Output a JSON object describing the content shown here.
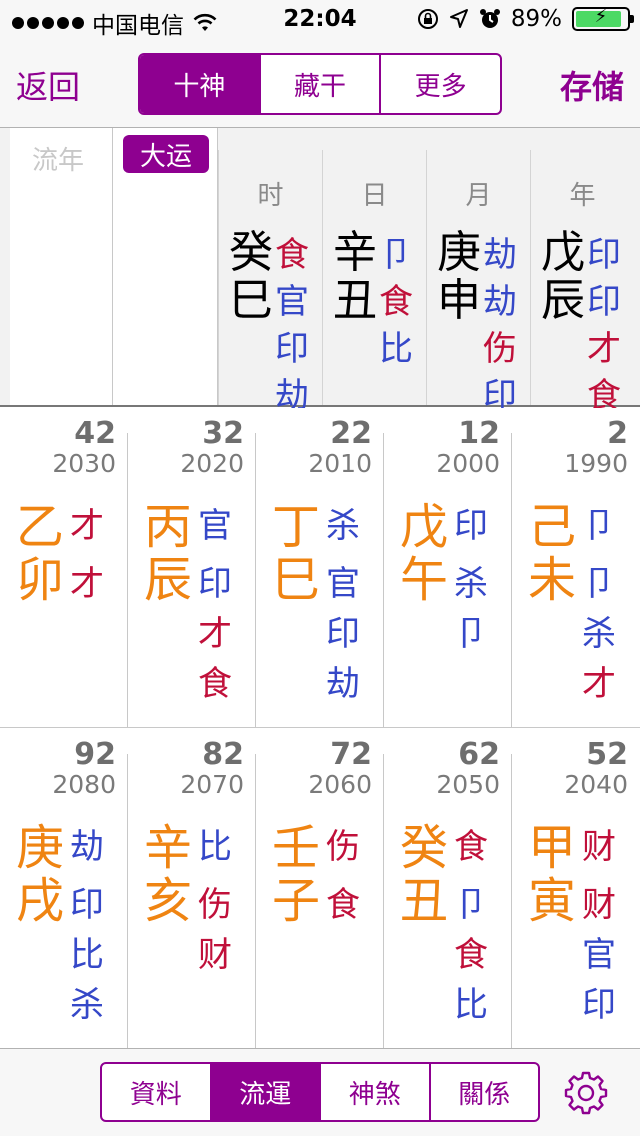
{
  "status_bar": {
    "carrier": "中国电信",
    "time": "22:04",
    "battery_percent": "89%",
    "battery_level": 0.89,
    "signal_icon": "signal-dots-icon",
    "wifi_icon": "wifi-icon",
    "battery_color": "#4cd964"
  },
  "nav": {
    "back_label": "返回",
    "save_label": "存储",
    "segments": [
      {
        "label": "十神",
        "active": true
      },
      {
        "label": "藏干",
        "active": false
      },
      {
        "label": "更多",
        "active": false
      }
    ],
    "accent_color": "#8e0090"
  },
  "header": {
    "liunian_label": "流年",
    "dayun_label": "大运",
    "pillars": [
      {
        "label": "时",
        "stem": "癸",
        "branch": "巳",
        "gods": [
          {
            "t": "食",
            "c": "red"
          },
          {
            "t": "官",
            "c": "blue"
          },
          {
            "t": "印",
            "c": "blue"
          },
          {
            "t": "劫",
            "c": "blue"
          }
        ]
      },
      {
        "label": "日",
        "stem": "辛",
        "branch": "丑",
        "gods": [
          {
            "t": "",
            "c": "blue"
          },
          {
            "t": "卩",
            "c": "blue"
          },
          {
            "t": "食",
            "c": "red"
          },
          {
            "t": "比",
            "c": "blue"
          }
        ]
      },
      {
        "label": "月",
        "stem": "庚",
        "branch": "申",
        "gods": [
          {
            "t": "劫",
            "c": "blue"
          },
          {
            "t": "劫",
            "c": "blue"
          },
          {
            "t": "伤",
            "c": "red"
          },
          {
            "t": "印",
            "c": "blue"
          }
        ]
      },
      {
        "label": "年",
        "stem": "戊",
        "branch": "辰",
        "gods": [
          {
            "t": "印",
            "c": "blue"
          },
          {
            "t": "印",
            "c": "blue"
          },
          {
            "t": "才",
            "c": "red"
          },
          {
            "t": "食",
            "c": "red"
          }
        ]
      }
    ]
  },
  "dayun_rows": [
    [
      {
        "age": "42",
        "year": "2030",
        "stem": "乙",
        "branch": "卯",
        "stem_god": {
          "t": "才",
          "c": "red"
        },
        "branch_gods": [
          {
            "t": "才",
            "c": "red"
          }
        ]
      },
      {
        "age": "32",
        "year": "2020",
        "stem": "丙",
        "branch": "辰",
        "stem_god": {
          "t": "官",
          "c": "blue"
        },
        "branch_gods": [
          {
            "t": "印",
            "c": "blue"
          },
          {
            "t": "才",
            "c": "red"
          },
          {
            "t": "食",
            "c": "red"
          }
        ]
      },
      {
        "age": "22",
        "year": "2010",
        "stem": "丁",
        "branch": "巳",
        "stem_god": {
          "t": "杀",
          "c": "blue"
        },
        "branch_gods": [
          {
            "t": "官",
            "c": "blue"
          },
          {
            "t": "印",
            "c": "blue"
          },
          {
            "t": "劫",
            "c": "blue"
          }
        ]
      },
      {
        "age": "12",
        "year": "2000",
        "stem": "戊",
        "branch": "午",
        "stem_god": {
          "t": "印",
          "c": "blue"
        },
        "branch_gods": [
          {
            "t": "杀",
            "c": "blue"
          },
          {
            "t": "卩",
            "c": "blue"
          }
        ]
      },
      {
        "age": "2",
        "year": "1990",
        "stem": "己",
        "branch": "未",
        "stem_god": {
          "t": "卩",
          "c": "blue"
        },
        "branch_gods": [
          {
            "t": "卩",
            "c": "blue"
          },
          {
            "t": "杀",
            "c": "blue"
          },
          {
            "t": "才",
            "c": "red"
          }
        ]
      }
    ],
    [
      {
        "age": "92",
        "year": "2080",
        "stem": "庚",
        "branch": "戌",
        "stem_god": {
          "t": "劫",
          "c": "blue"
        },
        "branch_gods": [
          {
            "t": "印",
            "c": "blue"
          },
          {
            "t": "比",
            "c": "blue"
          },
          {
            "t": "杀",
            "c": "blue"
          }
        ]
      },
      {
        "age": "82",
        "year": "2070",
        "stem": "辛",
        "branch": "亥",
        "stem_god": {
          "t": "比",
          "c": "blue"
        },
        "branch_gods": [
          {
            "t": "伤",
            "c": "red"
          },
          {
            "t": "财",
            "c": "red"
          }
        ]
      },
      {
        "age": "72",
        "year": "2060",
        "stem": "壬",
        "branch": "子",
        "stem_god": {
          "t": "伤",
          "c": "red"
        },
        "branch_gods": [
          {
            "t": "食",
            "c": "red"
          }
        ]
      },
      {
        "age": "62",
        "year": "2050",
        "stem": "癸",
        "branch": "丑",
        "stem_god": {
          "t": "食",
          "c": "red"
        },
        "branch_gods": [
          {
            "t": "卩",
            "c": "blue"
          },
          {
            "t": "食",
            "c": "red"
          },
          {
            "t": "比",
            "c": "blue"
          }
        ]
      },
      {
        "age": "52",
        "year": "2040",
        "stem": "甲",
        "branch": "寅",
        "stem_god": {
          "t": "财",
          "c": "red"
        },
        "branch_gods": [
          {
            "t": "财",
            "c": "red"
          },
          {
            "t": "官",
            "c": "blue"
          },
          {
            "t": "印",
            "c": "blue"
          }
        ]
      }
    ]
  ],
  "bottom": {
    "segments": [
      {
        "label": "資料",
        "active": false
      },
      {
        "label": "流運",
        "active": true
      },
      {
        "label": "神煞",
        "active": false
      },
      {
        "label": "關係",
        "active": false
      }
    ],
    "settings_icon": "gear-icon"
  },
  "colors": {
    "stem_orange": "#ef8412",
    "god_red": "#c0103a",
    "god_blue": "#3548c8"
  }
}
